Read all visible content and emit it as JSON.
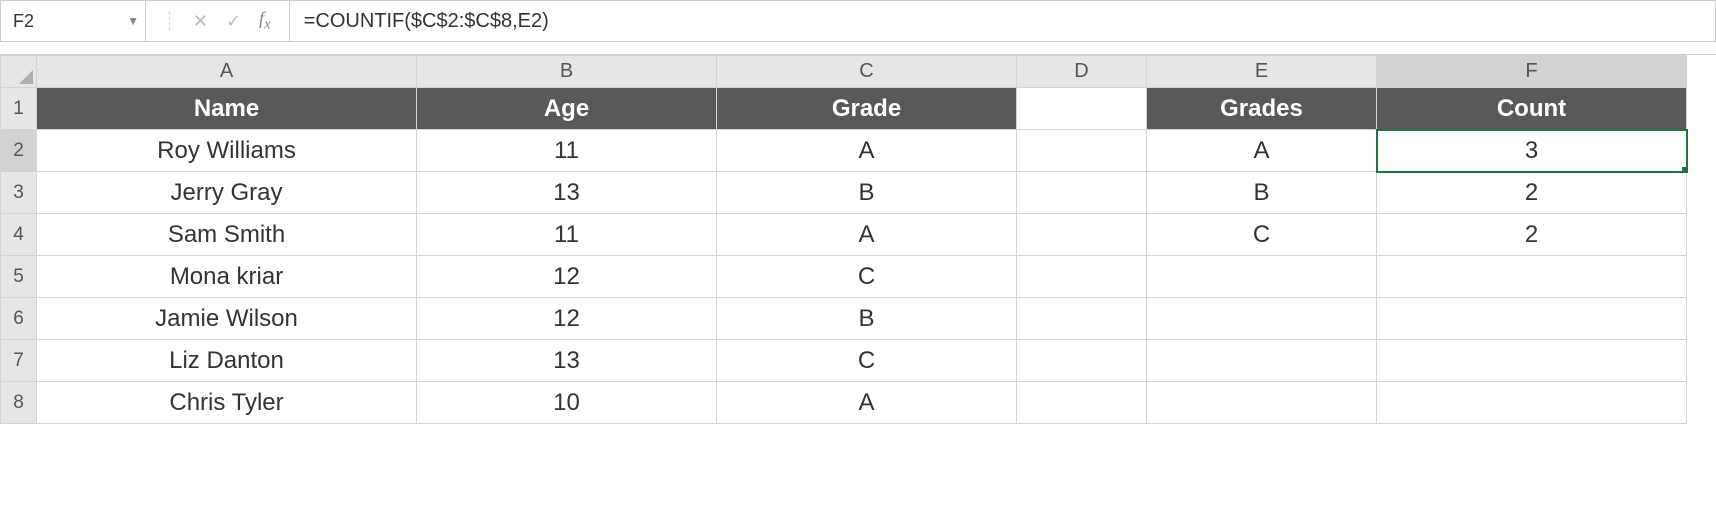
{
  "formula_bar": {
    "cell_ref": "F2",
    "formula": "=COUNTIF($C$2:$C$8,E2)"
  },
  "columns": [
    "A",
    "B",
    "C",
    "D",
    "E",
    "F"
  ],
  "row_numbers": [
    "1",
    "2",
    "3",
    "4",
    "5",
    "6",
    "7",
    "8"
  ],
  "selected": {
    "row": "2",
    "col": "F"
  },
  "headers": {
    "A": "Name",
    "B": "Age",
    "C": "Grade",
    "D": "",
    "E": "Grades",
    "F": "Count"
  },
  "rows": [
    {
      "A": "Roy Williams",
      "B": "11",
      "C": "A",
      "D": "",
      "E": "A",
      "F": "3"
    },
    {
      "A": "Jerry Gray",
      "B": "13",
      "C": "B",
      "D": "",
      "E": "B",
      "F": "2"
    },
    {
      "A": "Sam Smith",
      "B": "11",
      "C": "A",
      "D": "",
      "E": "C",
      "F": "2"
    },
    {
      "A": "Mona kriar",
      "B": "12",
      "C": "C",
      "D": "",
      "E": "",
      "F": ""
    },
    {
      "A": "Jamie Wilson",
      "B": "12",
      "C": "B",
      "D": "",
      "E": "",
      "F": ""
    },
    {
      "A": "Liz Danton",
      "B": "13",
      "C": "C",
      "D": "",
      "E": "",
      "F": ""
    },
    {
      "A": "Chris Tyler",
      "B": "10",
      "C": "A",
      "D": "",
      "E": "",
      "F": ""
    }
  ]
}
